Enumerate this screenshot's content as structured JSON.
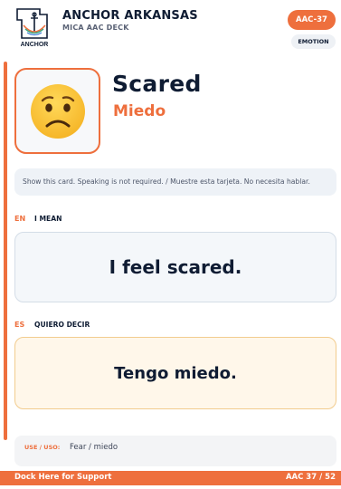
{
  "colors": {
    "accent": "#ee6f3d",
    "navy": "#0f1c33",
    "muted": "#5a6275",
    "en_box": "#f4f7fa",
    "es_box": "#fff7ea",
    "es_border": "#f2cc8e"
  },
  "header": {
    "logo_icon": "anchor-arrow-icon",
    "logo_text": "ANCHOR",
    "brand": "ANCHOR ARKANSAS",
    "deck": "MICA AAC DECK",
    "code": "AAC-37",
    "category": "EMOTION"
  },
  "card": {
    "emoji_icon": "worried-face-icon",
    "title_en": "Scared",
    "title_es": "Miedo",
    "instruction": "Show this card. Speaking is not required. / Muestre esta tarjeta. No necesita hablar."
  },
  "en": {
    "code": "EN",
    "label": "I MEAN",
    "phrase": "I feel scared."
  },
  "es": {
    "code": "ES",
    "label": "QUIERO DECIR",
    "phrase": "Tengo miedo."
  },
  "use": {
    "label": "USE / USO:",
    "text": "Fear / miedo"
  },
  "footer": {
    "left": "Dock Here for Support",
    "right": "AAC 37 / 52"
  }
}
